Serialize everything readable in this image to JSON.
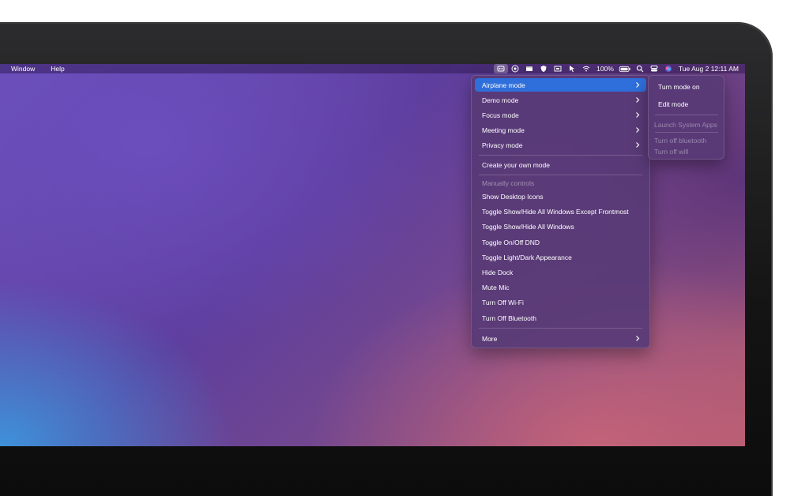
{
  "menubar": {
    "app_menus": [
      "Window",
      "Help"
    ],
    "icons": [
      "modes-app-icon",
      "focus-icon",
      "window-icon",
      "shield-icon",
      "display-icon",
      "cursor-icon",
      "wifi-icon"
    ],
    "battery_percent": "100%",
    "datetime": "Tue Aug 2  12:11 AM"
  },
  "menu": {
    "modes": [
      {
        "label": "Airplane mode",
        "has_submenu": true,
        "highlighted": true
      },
      {
        "label": "Demo mode",
        "has_submenu": true
      },
      {
        "label": "Focus mode",
        "has_submenu": true
      },
      {
        "label": "Meeting mode",
        "has_submenu": true
      },
      {
        "label": "Privacy mode",
        "has_submenu": true
      }
    ],
    "create_label": "Create your own mode",
    "manual_header": "Manually controls",
    "controls": [
      "Show Desktop Icons",
      "Toggle Show/Hide All Windows Except Frontmost",
      "Toggle Show/Hide All Windows",
      "Toggle On/Off DND",
      "Toggle Light/Dark Appearance",
      "Hide Dock",
      "Mute Mic",
      "Turn Off Wi-Fi",
      "Turn Off Bluetooth"
    ],
    "more_label": "More"
  },
  "submenu": {
    "turn_on": "Turn mode on",
    "edit": "Edit mode",
    "launch": "Launch System Apps",
    "bt_off": "Turn off bluetooth",
    "wifi_off": "Turn off wifi"
  },
  "colors": {
    "highlight": "#2f6fdb",
    "menu_bg": "#583a76"
  }
}
